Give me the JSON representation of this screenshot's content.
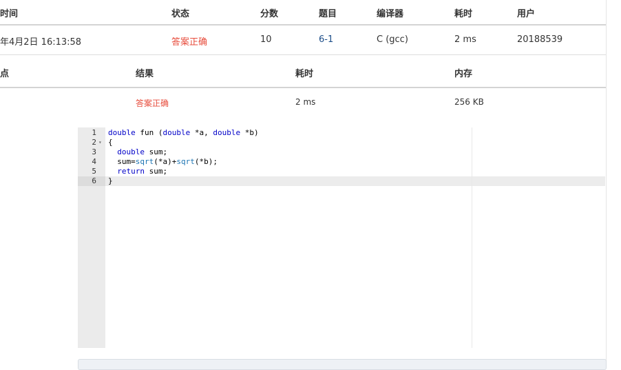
{
  "submission": {
    "headers": {
      "time": "时间",
      "status": "状态",
      "score": "分数",
      "problem": "题目",
      "compiler": "编译器",
      "duration": "耗时",
      "user": "用户"
    },
    "row": {
      "time": "年4月2日 16:13:58",
      "status": "答案正确",
      "score": "10",
      "problem": "6-1",
      "compiler": "C (gcc)",
      "duration": "2 ms",
      "user": "20188539"
    }
  },
  "testcases": {
    "headers": {
      "point": "点",
      "result": "结果",
      "duration": "耗时",
      "memory": "内存"
    },
    "row": {
      "result": "答案正确",
      "duration": "2 ms",
      "memory": "256 KB"
    }
  },
  "editor": {
    "line_numbers": [
      "1",
      "2",
      "3",
      "4",
      "5",
      "6"
    ],
    "fold_marker": "▾",
    "active_line": 6,
    "code": {
      "l1_kw1": "double",
      "l1_fn": " fun (",
      "l1_kw2": "double",
      "l1_mid": " *a, ",
      "l1_kw3": "double",
      "l1_end": " *b)",
      "l2": "{",
      "l3_indent": "  ",
      "l3_kw": "double",
      "l3_rest": " sum;",
      "l4_start": "  sum=",
      "l4_fn1": "sqrt",
      "l4_mid": "(*a)+",
      "l4_fn2": "sqrt",
      "l4_end": "(*b);",
      "l5_indent": "  ",
      "l5_kw": "return",
      "l5_rest": " sum;",
      "l6": "}"
    }
  },
  "colors": {
    "status_ok": "#e74c3c",
    "link": "#1e4f8a",
    "keyword": "#0000c8"
  }
}
